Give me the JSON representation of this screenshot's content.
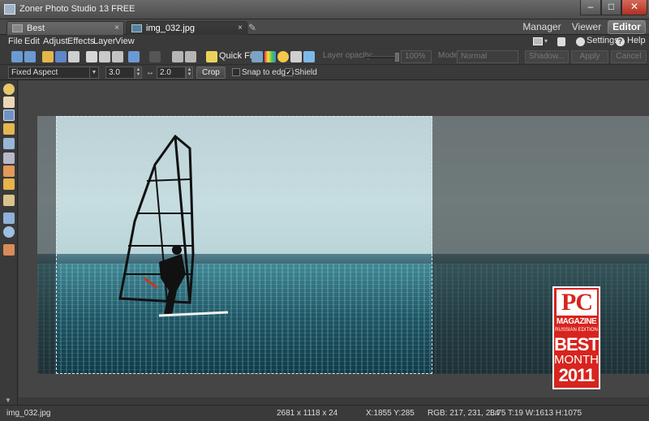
{
  "window": {
    "title": "Zoner Photo Studio 13 FREE"
  },
  "tabs": [
    {
      "label": "Best",
      "close": "×"
    },
    {
      "label": "img_032.jpg",
      "close": "×"
    }
  ],
  "modes": {
    "manager": "Manager",
    "viewer": "Viewer",
    "editor": "Editor"
  },
  "menu": {
    "items": [
      "File",
      "Edit",
      "Adjust",
      "Effects",
      "Layer",
      "View"
    ],
    "settings": "Settings",
    "help": "Help"
  },
  "toolbar": {
    "quick_fix": "Quick Fix",
    "layer_opacity_label": "Layer opacity:",
    "layer_opacity_value": "100%",
    "mode_label": "Mode:",
    "mode_value": "Normal",
    "shadow_button": "Shadow...",
    "apply_button": "Apply",
    "cancel_button": "Cancel"
  },
  "crop_options": {
    "aspect_mode": "Fixed Aspect",
    "width_ratio": "3.0",
    "height_ratio": "2.0",
    "crop_button": "Crop",
    "snap_to_edges_label": "Snap to edges",
    "snap_to_edges_checked": false,
    "shield_label": "Shield",
    "shield_checked": true,
    "swap_icon": "↔"
  },
  "badge": {
    "pc": "PC",
    "magazine": "MAGAZINE",
    "edition": "RUSSIAN EDITION",
    "best": "BEST",
    "month": "MONTH",
    "year": "2011"
  },
  "status": {
    "filename": "img_032.jpg",
    "dimensions": "2681 x 1118 x 24",
    "cursor": "X:1855 Y:285",
    "rgb": "RGB: 217, 231, 234",
    "crop_rect": "L:75  T:19  W:1613  H:1075"
  },
  "colors": {
    "accent_red": "#d8241e",
    "background": "#3a3a3a"
  }
}
